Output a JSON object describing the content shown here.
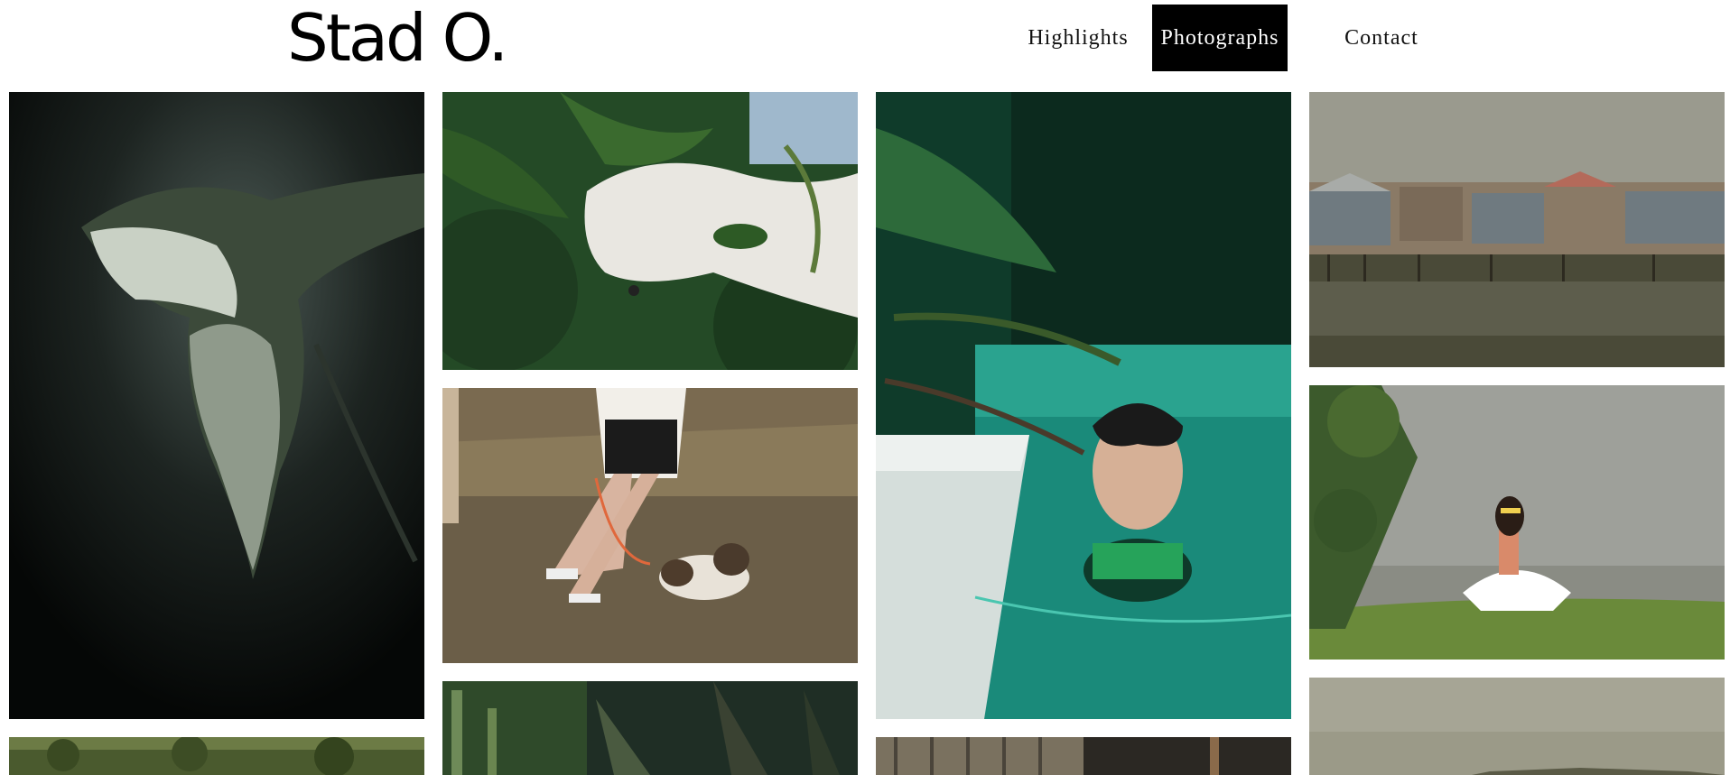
{
  "site": {
    "logo": "Stad O."
  },
  "nav": [
    {
      "label": "Highlights",
      "active": false
    },
    {
      "label": "Photographs",
      "active": true
    },
    {
      "label": "Contact",
      "active": false
    }
  ],
  "colors": {
    "accent_bg": "#000000",
    "page_bg": "#ffffff"
  },
  "photos": [
    {
      "subject": "leaf"
    },
    {
      "subject": "white dog in bush"
    },
    {
      "subject": "person walking dog"
    },
    {
      "subject": "boy in pool"
    },
    {
      "subject": "stilt houses over water"
    },
    {
      "subject": "woman sitting on hill"
    },
    {
      "subject": "forest canopy"
    },
    {
      "subject": "cactus garden"
    },
    {
      "subject": "wooden structure"
    },
    {
      "subject": "cloudy sky"
    }
  ]
}
